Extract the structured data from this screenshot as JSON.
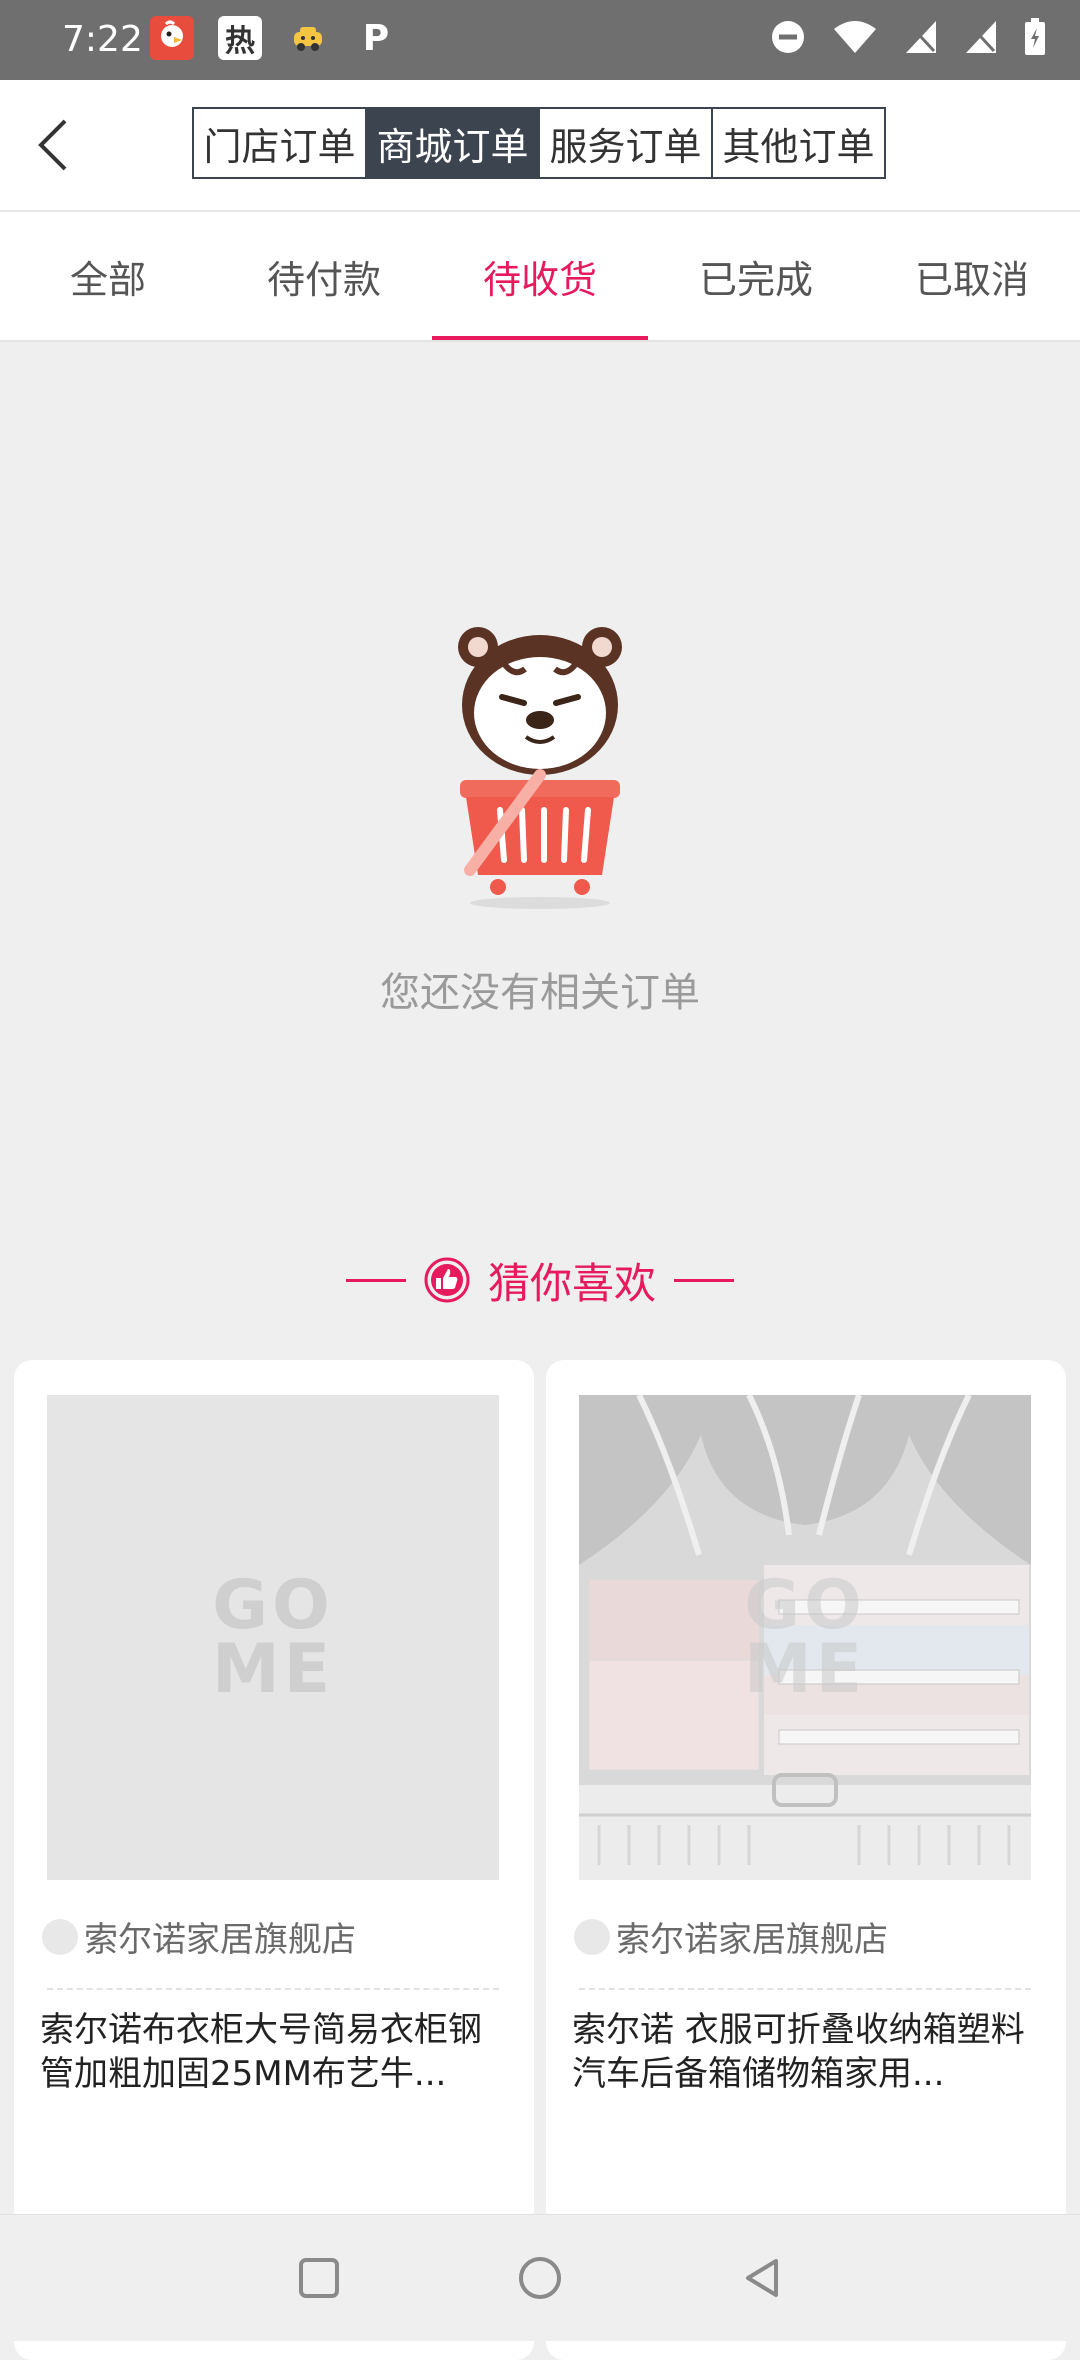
{
  "status_bar": {
    "time": "7:22",
    "left_icons": [
      "app-chicken-icon",
      "hot-news-icon",
      "taxi-icon",
      "parking-icon"
    ],
    "hot_label": "热",
    "p_label": "P",
    "right_icons": [
      "dnd-icon",
      "wifi-icon",
      "signal-1-icon",
      "signal-2-icon",
      "battery-icon"
    ]
  },
  "header": {
    "back_icon": "chevron-left-icon",
    "segments": [
      "门店订单",
      "商城订单",
      "服务订单",
      "其他订单"
    ],
    "active_segment": 1
  },
  "tabs": {
    "items": [
      "全部",
      "待付款",
      "待收货",
      "已完成",
      "已取消"
    ],
    "active_index": 2
  },
  "empty_state": {
    "illustration": "tiger-in-basket",
    "message": "您还没有相关订单"
  },
  "recommend": {
    "icon": "thumbs-up-icon",
    "title": "猜你喜欢"
  },
  "products": [
    {
      "store": "索尔诺家居旗舰店",
      "title": "索尔诺布衣柜大号简易衣柜钢管加粗加固25MM布艺牛...",
      "image": "placeholder"
    },
    {
      "store": "索尔诺家居旗舰店",
      "title": "索尔诺 衣服可折叠收纳箱塑料汽车后备箱储物箱家用...",
      "image": "storage-boxes-photo"
    }
  ],
  "placeholder_logo": "GOME",
  "nav_bar": {
    "buttons": [
      "recent-apps-icon",
      "home-icon",
      "back-icon"
    ]
  },
  "colors": {
    "accent": "#e61a5c",
    "segment_active": "#3c4450",
    "status_bar": "#6f6f6f",
    "page_bg": "#efefef"
  }
}
